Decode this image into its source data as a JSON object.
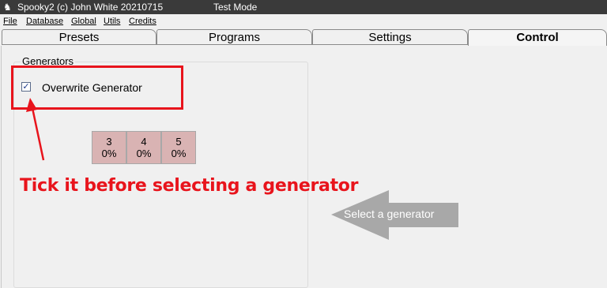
{
  "window": {
    "title": "Spooky2 (c) John White 20210715",
    "mode": "Test Mode"
  },
  "menu": [
    "File",
    "Database",
    "Global",
    "Utils",
    "Credits"
  ],
  "tabs": [
    {
      "label": "Presets"
    },
    {
      "label": "Programs"
    },
    {
      "label": "Settings"
    },
    {
      "label": "Control"
    }
  ],
  "active_tab": "Control",
  "generators_group": {
    "title": "Generators",
    "overwrite_label": "Overwrite Generator",
    "overwrite_checked": true,
    "buttons": [
      {
        "num": "3",
        "pct": "0%"
      },
      {
        "num": "4",
        "pct": "0%"
      },
      {
        "num": "5",
        "pct": "0%"
      }
    ]
  },
  "annotations": {
    "instruction": "Tick it before selecting a generator",
    "arrow_label": "Select a generator",
    "highlight_color": "#e8141c",
    "arrow_color": "#a8a8a8"
  }
}
